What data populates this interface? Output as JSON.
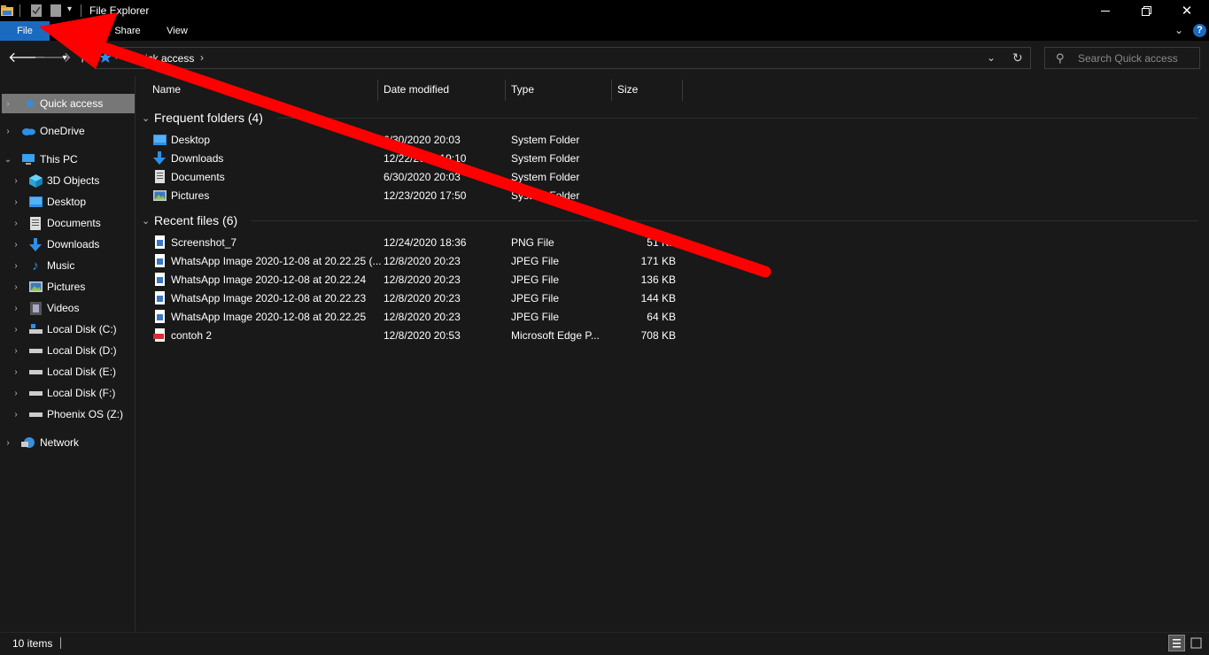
{
  "window": {
    "title": "File Explorer"
  },
  "ribbon": {
    "tabs": [
      "File",
      "Home",
      "Share",
      "View"
    ]
  },
  "nav": {
    "breadcrumb": "Quick access",
    "search_placeholder": "Search Quick access"
  },
  "sidebar": {
    "items": [
      {
        "label": "Quick access",
        "icon": "star-icon"
      },
      {
        "label": "OneDrive",
        "icon": "cloud-icon"
      },
      {
        "label": "This PC",
        "icon": "computer-icon"
      },
      {
        "label": "3D Objects",
        "icon": "cube-icon"
      },
      {
        "label": "Desktop",
        "icon": "desktop-icon"
      },
      {
        "label": "Documents",
        "icon": "document-icon"
      },
      {
        "label": "Downloads",
        "icon": "download-icon"
      },
      {
        "label": "Music",
        "icon": "music-icon"
      },
      {
        "label": "Pictures",
        "icon": "pictures-icon"
      },
      {
        "label": "Videos",
        "icon": "videos-icon"
      },
      {
        "label": "Local Disk (C:)",
        "icon": "drive-icon"
      },
      {
        "label": "Local Disk (D:)",
        "icon": "drive-icon"
      },
      {
        "label": "Local Disk (E:)",
        "icon": "drive-icon"
      },
      {
        "label": "Local Disk (F:)",
        "icon": "drive-icon"
      },
      {
        "label": "Phoenix OS (Z:)",
        "icon": "drive-icon"
      },
      {
        "label": "Network",
        "icon": "network-icon"
      }
    ]
  },
  "columns": {
    "name": "Name",
    "date": "Date modified",
    "type": "Type",
    "size": "Size"
  },
  "groups": {
    "frequent": {
      "title": "Frequent folders (4)",
      "rows": [
        {
          "name": "Desktop",
          "date": "6/30/2020 20:03",
          "type": "System Folder",
          "size": ""
        },
        {
          "name": "Downloads",
          "date": "12/22/2020 19:10",
          "type": "System Folder",
          "size": ""
        },
        {
          "name": "Documents",
          "date": "6/30/2020 20:03",
          "type": "System Folder",
          "size": ""
        },
        {
          "name": "Pictures",
          "date": "12/23/2020 17:50",
          "type": "System Folder",
          "size": ""
        }
      ]
    },
    "recent": {
      "title": "Recent files (6)",
      "rows": [
        {
          "name": "Screenshot_7",
          "date": "12/24/2020 18:36",
          "type": "PNG File",
          "size": "51 KB"
        },
        {
          "name": "WhatsApp Image 2020-12-08 at 20.22.25 (...",
          "date": "12/8/2020 20:23",
          "type": "JPEG File",
          "size": "171 KB"
        },
        {
          "name": "WhatsApp Image 2020-12-08 at 20.22.24",
          "date": "12/8/2020 20:23",
          "type": "JPEG File",
          "size": "136 KB"
        },
        {
          "name": "WhatsApp Image 2020-12-08 at 20.22.23",
          "date": "12/8/2020 20:23",
          "type": "JPEG File",
          "size": "144 KB"
        },
        {
          "name": "WhatsApp Image 2020-12-08 at 20.22.25",
          "date": "12/8/2020 20:23",
          "type": "JPEG File",
          "size": "64 KB"
        },
        {
          "name": "contoh 2",
          "date": "12/8/2020 20:53",
          "type": "Microsoft Edge P...",
          "size": "708 KB"
        }
      ]
    }
  },
  "status": {
    "items": "10 items"
  },
  "colors": {
    "accent": "#1a6bc0",
    "annotation_arrow": "#ff0000",
    "background": "#191919"
  }
}
